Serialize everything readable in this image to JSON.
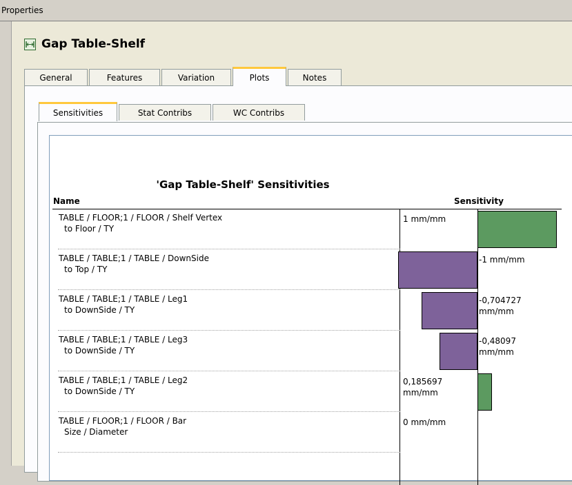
{
  "window": {
    "title": "Properties"
  },
  "heading": {
    "icon": "dimension-gap-icon",
    "title": "Gap Table-Shelf"
  },
  "tabs": [
    {
      "label": "General",
      "active": false
    },
    {
      "label": "Features",
      "active": false
    },
    {
      "label": "Variation",
      "active": false
    },
    {
      "label": "Plots",
      "active": true
    },
    {
      "label": "Notes",
      "active": false
    }
  ],
  "subtabs": [
    {
      "label": "Sensitivities",
      "active": true
    },
    {
      "label": "Stat Contribs",
      "active": false
    },
    {
      "label": "WC Contribs",
      "active": false
    }
  ],
  "report": {
    "title": "'Gap Table-Shelf' Sensitivities",
    "col_name": "Name",
    "col_sensitivity": "Sensitivity",
    "rows": [
      {
        "line1": "TABLE / FLOOR;1 / FLOOR / Shelf Vertex",
        "line2": "to Floor / TY",
        "value_line1": "1 mm/mm",
        "value_line2": ""
      },
      {
        "line1": "TABLE / TABLE;1 / TABLE / DownSide",
        "line2": "to Top / TY",
        "value_line1": "-1 mm/mm",
        "value_line2": ""
      },
      {
        "line1": "TABLE / TABLE;1 / TABLE / Leg1",
        "line2": "to DownSide / TY",
        "value_line1": "-0,704727",
        "value_line2": "mm/mm"
      },
      {
        "line1": "TABLE / TABLE;1 / TABLE / Leg3",
        "line2": "to DownSide / TY",
        "value_line1": "-0,48097",
        "value_line2": "mm/mm"
      },
      {
        "line1": "TABLE / TABLE;1 / TABLE / Leg2",
        "line2": "to DownSide / TY",
        "value_line1": "0,185697",
        "value_line2": "mm/mm"
      },
      {
        "line1": "TABLE / FLOOR;1 / FLOOR / Bar",
        "line2": "Size / Diameter",
        "value_line1": "0 mm/mm",
        "value_line2": ""
      }
    ]
  },
  "chart_data": {
    "type": "bar",
    "orientation": "horizontal",
    "title": "'Gap Table-Shelf' Sensitivities",
    "categories": [
      "TABLE / FLOOR;1 / FLOOR / Shelf Vertex to Floor / TY",
      "TABLE / TABLE;1 / TABLE / DownSide to Top / TY",
      "TABLE / TABLE;1 / TABLE / Leg1 to DownSide / TY",
      "TABLE / TABLE;1 / TABLE / Leg3 to DownSide / TY",
      "TABLE / TABLE;1 / TABLE / Leg2 to DownSide / TY",
      "TABLE / FLOOR;1 / FLOOR / Bar Size / Diameter"
    ],
    "values": [
      1,
      -1,
      -0.704727,
      -0.48097,
      0.185697,
      0
    ],
    "unit": "mm/mm",
    "xlim": [
      -1,
      1
    ],
    "colors": {
      "positive": "#5c9a60",
      "negative": "#7e629a"
    }
  }
}
